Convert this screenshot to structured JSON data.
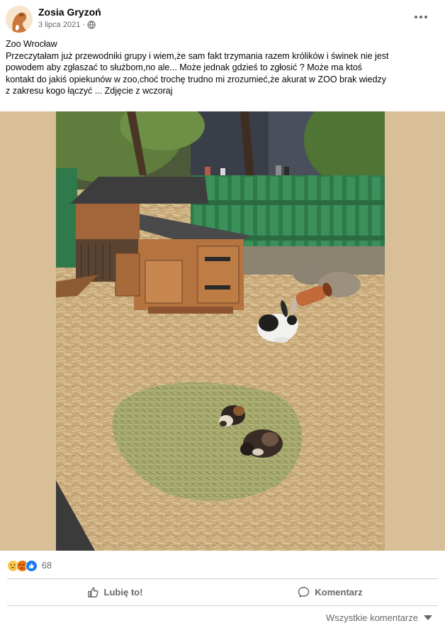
{
  "post": {
    "author": "Zosia Gryzoń",
    "date": "3 lipca 2021",
    "date_separator": "·",
    "privacy_icon": "globe-icon",
    "more_icon": "more-options-icon",
    "text_lines": [
      "Zoo Wrocław",
      "Przeczytałam już przewodniki grupy i wiem,że sam fakt trzymania razem królików i świnek nie jest",
      "powodem aby zgłaszać to służbom,no ale... Może jednak gdzieś to zgłosić ? Może ma ktoś",
      "kontakt do jakiś opiekunów w zoo,choć trochę trudno mi zrozumieć,że akurat w ZOO brak wiedzy",
      "z zakresu kogo łączyć ... Zdjęcie z wczoraj"
    ],
    "photo_description_icon": "photo-rabbit-guinea-pigs-enclosure",
    "reactions": {
      "icons": [
        "sad-reaction-icon",
        "angry-reaction-icon",
        "like-reaction-icon"
      ],
      "count": "68"
    },
    "actions": {
      "like_label": "Lubię to!",
      "comment_label": "Komentarz"
    },
    "comments_filter_label": "Wszystkie komentarze"
  },
  "colors": {
    "secondary_text": "#65676b",
    "photo_background": "#d8bf97",
    "like_blue": "#1877f2",
    "divider": "#ced0d4"
  }
}
